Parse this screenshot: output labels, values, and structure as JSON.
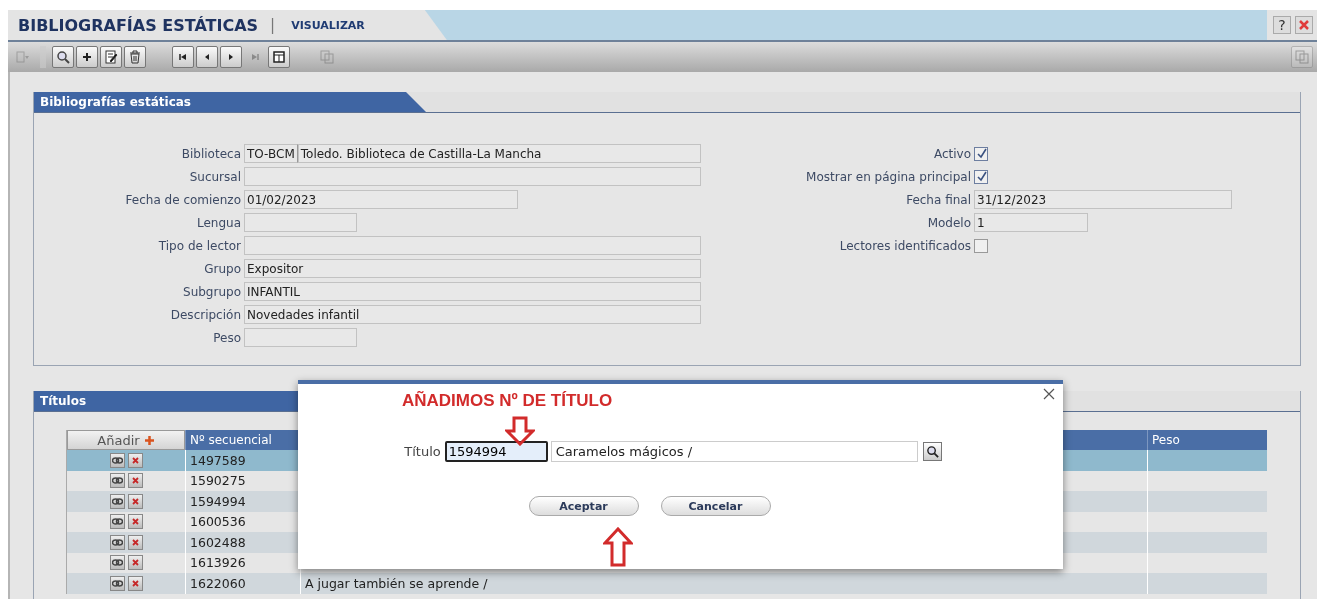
{
  "header": {
    "title": "BIBLIOGRAFÍAS ESTÁTICAS",
    "separator": "|",
    "mode": "VISUALIZAR",
    "help": "?"
  },
  "toolbar": [
    {
      "kind": "menu",
      "disabled": true
    },
    {
      "kind": "sep"
    },
    {
      "kind": "search",
      "disabled": false
    },
    {
      "kind": "add",
      "disabled": false
    },
    {
      "kind": "edit",
      "disabled": false
    },
    {
      "kind": "delete",
      "disabled": false
    },
    {
      "kind": "gap"
    },
    {
      "kind": "first",
      "disabled": false
    },
    {
      "kind": "prev",
      "disabled": false
    },
    {
      "kind": "next",
      "disabled": false
    },
    {
      "kind": "last",
      "disabled": true
    },
    {
      "kind": "grid",
      "disabled": false
    },
    {
      "kind": "gap"
    },
    {
      "kind": "copy",
      "disabled": true
    }
  ],
  "form": {
    "title": "Bibliografías estáticas",
    "rows": [
      {
        "left": {
          "label": "Biblioteca",
          "code": "TO-BCM",
          "value": "Toledo. Biblioteca de Castilla-La Mancha"
        },
        "right": {
          "label": "Activo",
          "kind": "checkbox",
          "checked": true
        }
      },
      {
        "left": {
          "label": "Sucursal"
        },
        "right": {
          "label": "Mostrar en página principal",
          "kind": "checkbox",
          "checked": true
        }
      },
      {
        "left": {
          "label": "Fecha de comienzo",
          "value": "01/02/2023"
        },
        "right": {
          "label": "Fecha final",
          "kind": "text",
          "value": "31/12/2023"
        }
      },
      {
        "left": {
          "label": "Lengua"
        },
        "right": {
          "label": "Modelo",
          "kind": "text",
          "value": "1"
        }
      },
      {
        "left": {
          "label": "Tipo de lector"
        },
        "right": {
          "label": "Lectores identificados",
          "kind": "checkbox",
          "checked": false
        }
      },
      {
        "left": {
          "label": "Grupo",
          "value": "Expositor"
        }
      },
      {
        "left": {
          "label": "Subgrupo",
          "value": "INFANTIL"
        }
      },
      {
        "left": {
          "label": "Descripción",
          "value": "Novedades infantil"
        }
      },
      {
        "left": {
          "label": "Peso"
        }
      }
    ]
  },
  "titles": {
    "title": "Títulos",
    "add_label": "Añadir",
    "columns": [
      "Nº secuencial",
      "Peso"
    ],
    "rows": [
      {
        "number": "1497589",
        "selected": true
      },
      {
        "number": "1590275",
        "selected": false
      },
      {
        "number": "1594994",
        "selected": false
      },
      {
        "number": "1600536",
        "selected": false
      },
      {
        "number": "1602488",
        "selected": false
      },
      {
        "number": "1613926",
        "selected": false
      },
      {
        "number": "1622060",
        "title": "A jugar también se aprende /",
        "selected": false
      }
    ]
  },
  "dialog": {
    "annotation": "AÑADIMOS  Nº DE TÍTULO",
    "label": "Título",
    "number": "1594994",
    "title": "Caramelos mágicos /",
    "buttons": [
      "Aceptar",
      "Cancelar"
    ]
  }
}
